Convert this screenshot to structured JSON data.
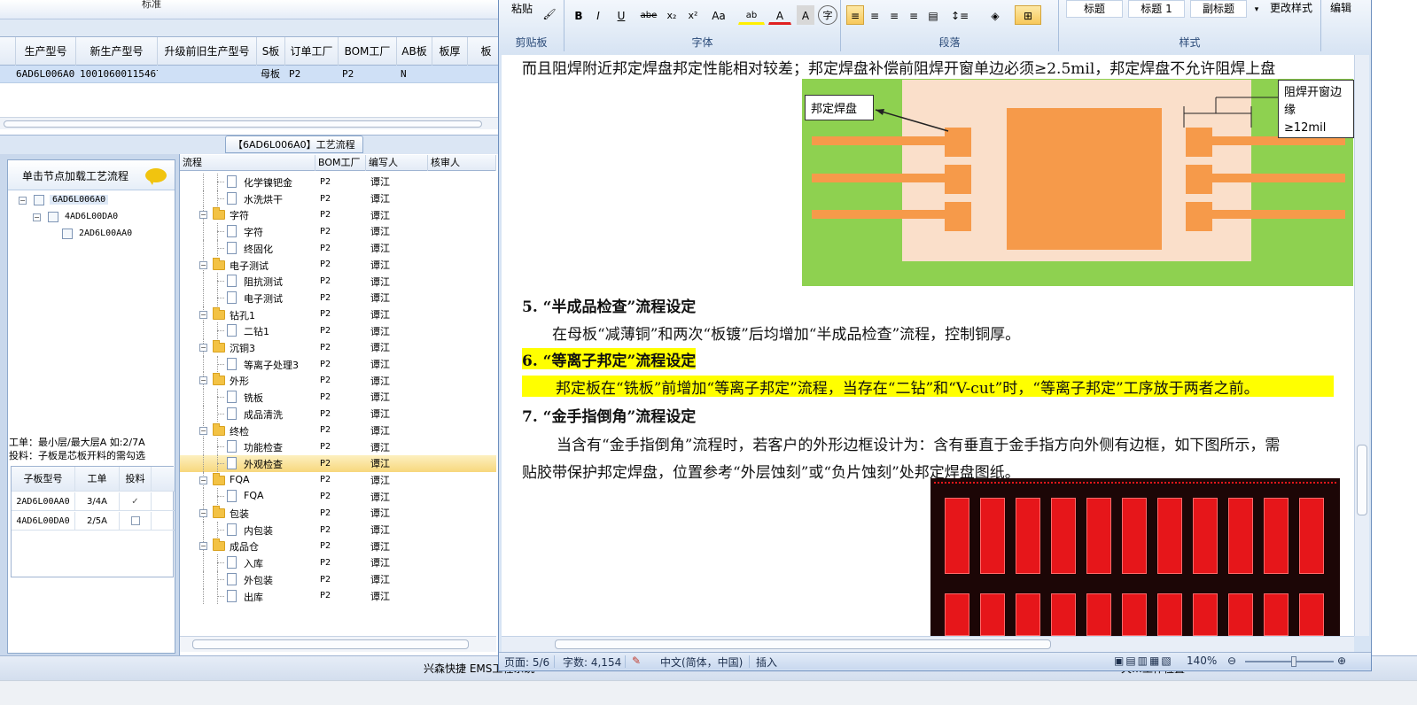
{
  "erp": {
    "topstrip_text": "标准",
    "grid": {
      "headers": [
        "生产型号",
        "新生产型号",
        "升级前旧生产型号",
        "S板",
        "订单工厂",
        "BOM工厂",
        "AB板",
        "板厚",
        "板"
      ],
      "row": [
        "6AD6L006A0",
        "10010600115467",
        "",
        "母板",
        "P2",
        "P2",
        "N",
        "",
        ""
      ]
    },
    "flow_tab": "【6AD6L006A0】工艺流程",
    "left_panel": {
      "title": "单击节点加载工艺流程",
      "tree": [
        "6AD6L006A0",
        "4AD6L00DA0",
        "2AD6L00AA0"
      ],
      "info_line1": "工单：最小层/最大层A 如:2/7A",
      "info_line2": "投料：子板是芯板开料的需勾选",
      "table_headers": [
        "子板型号",
        "工单",
        "投料"
      ],
      "table_rows": [
        [
          "2AD6L00AA0",
          "3/4A",
          "✓"
        ],
        [
          "4AD6L00DA0",
          "2/5A",
          ""
        ]
      ]
    },
    "flow_grid": {
      "headers": [
        "流程",
        "BOM工厂",
        "编写人",
        "核审人"
      ],
      "rows": [
        {
          "name": "化学镍钯金",
          "type": "doc",
          "bom": "P2",
          "writer": "谭江"
        },
        {
          "name": "水洗烘干",
          "type": "doc",
          "bom": "P2",
          "writer": "谭江"
        },
        {
          "name": "字符",
          "type": "folder",
          "bom": "P2",
          "writer": "谭江"
        },
        {
          "name": "字符",
          "type": "doc",
          "bom": "P2",
          "writer": "谭江"
        },
        {
          "name": "终固化",
          "type": "doc",
          "bom": "P2",
          "writer": "谭江"
        },
        {
          "name": "电子测试",
          "type": "folder",
          "bom": "P2",
          "writer": "谭江"
        },
        {
          "name": "阻抗测试",
          "type": "doc",
          "bom": "P2",
          "writer": "谭江"
        },
        {
          "name": "电子测试",
          "type": "doc",
          "bom": "P2",
          "writer": "谭江"
        },
        {
          "name": "钻孔1",
          "type": "folder",
          "bom": "P2",
          "writer": "谭江"
        },
        {
          "name": "二钻1",
          "type": "doc",
          "bom": "P2",
          "writer": "谭江"
        },
        {
          "name": "沉铜3",
          "type": "folder",
          "bom": "P2",
          "writer": "谭江"
        },
        {
          "name": "等离子处理3",
          "type": "doc",
          "bom": "P2",
          "writer": "谭江"
        },
        {
          "name": "外形",
          "type": "folder",
          "bom": "P2",
          "writer": "谭江"
        },
        {
          "name": "铣板",
          "type": "doc",
          "bom": "P2",
          "writer": "谭江"
        },
        {
          "name": "成品清洗",
          "type": "doc",
          "bom": "P2",
          "writer": "谭江"
        },
        {
          "name": "终检",
          "type": "folder",
          "bom": "P2",
          "writer": "谭江"
        },
        {
          "name": "功能检查",
          "type": "doc",
          "bom": "P2",
          "writer": "谭江"
        },
        {
          "name": "外观检查",
          "type": "doc",
          "bom": "P2",
          "writer": "谭江",
          "selected": true
        },
        {
          "name": "FQA",
          "type": "folder",
          "bom": "P2",
          "writer": "谭江"
        },
        {
          "name": "FQA",
          "type": "doc",
          "bom": "P2",
          "writer": "谭江"
        },
        {
          "name": "包装",
          "type": "folder",
          "bom": "P2",
          "writer": "谭江"
        },
        {
          "name": "内包装",
          "type": "doc",
          "bom": "P2",
          "writer": "谭江"
        },
        {
          "name": "成品仓",
          "type": "folder",
          "bom": "P2",
          "writer": "谭江"
        },
        {
          "name": "入库",
          "type": "doc",
          "bom": "P2",
          "writer": "谭江"
        },
        {
          "name": "外包装",
          "type": "doc",
          "bom": "P2",
          "writer": "谭江"
        },
        {
          "name": "出库",
          "type": "doc",
          "bom": "P2",
          "writer": "谭江"
        }
      ]
    },
    "status_text": "兴森快捷 EMS工程系统",
    "status_right": "天…工作位置"
  },
  "word": {
    "ribbon": {
      "paste": "粘贴",
      "clipboard_label": "剪贴板",
      "font_label": "字体",
      "paragraph_label": "段落",
      "styles_label": "样式",
      "styles": [
        "标题",
        "标题 1",
        "副标题"
      ],
      "change_styles": "更改样式",
      "edit": "编辑",
      "font_buttons": [
        "B",
        "I",
        "U",
        "abe",
        "x₂",
        "x²",
        "Aa",
        "ab",
        "A",
        "A",
        "字"
      ]
    },
    "doc": {
      "top_line": "而且阻焊附近邦定焊盘邦定性能相对较差；邦定焊盘补偿前阻焊开窗单边必须≥2.5mil，邦定焊盘不允许阻焊上盘",
      "callout_left": "邦定焊盘",
      "callout_right_1": "阻焊开窗边缘",
      "callout_right_2": "≥12mil",
      "h5": "5. “半成品检查”流程设定",
      "p5": "在母板“减薄铜”和两次“板镀”后均增加“半成品检查”流程，控制铜厚。",
      "h6": "6.  “等离子邦定”流程设定",
      "p6": "邦定板在“铣板”前增加“等离子邦定”流程，当存在“二钻”和“V-cut”时，“等离子邦定”工序放于两者之前。",
      "h7": "7.  “金手指倒角”流程设定",
      "p7a": "当含有“金手指倒角”流程时，若客户的外形边框设计为：含有垂直于金手指方向外侧有边框，如下图所示，需",
      "p7b": "贴胶带保护邦定焊盘，位置参考“外层蚀刻”或“负片蚀刻”处邦定焊盘图纸。"
    },
    "status": {
      "page": "页面: 5/6",
      "words": "字数: 4,154",
      "lang": "中文(简体，中国)",
      "insert": "插入",
      "zoom": "140%"
    }
  }
}
